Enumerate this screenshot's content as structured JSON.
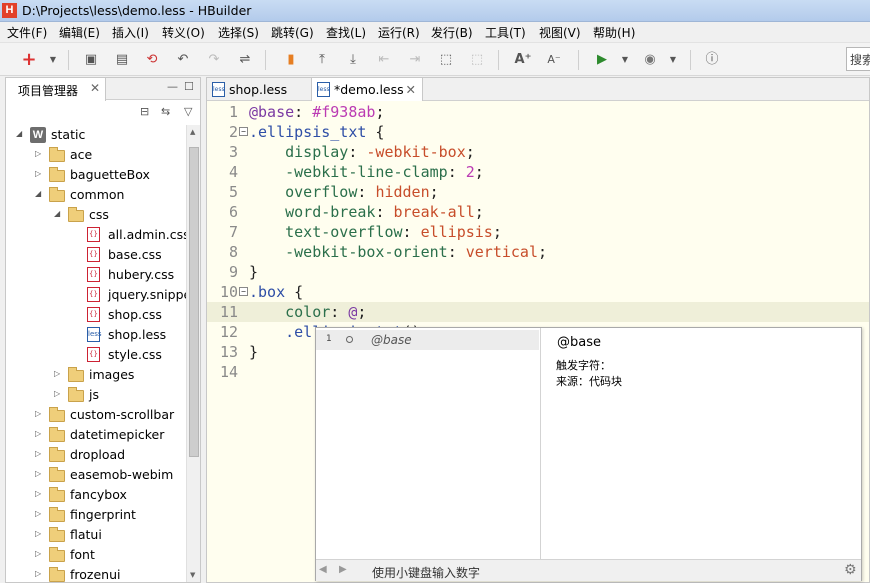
{
  "window": {
    "title": "D:\\Projects\\less\\demo.less  -  HBuilder",
    "logo": "H"
  },
  "menu": [
    "文件(F)",
    "编辑(E)",
    "插入(I)",
    "转义(O)",
    "选择(S)",
    "跳转(G)",
    "查找(L)",
    "运行(R)",
    "发行(B)",
    "工具(T)",
    "视图(V)",
    "帮助(H)"
  ],
  "toolbar": {
    "search_label": "搜索"
  },
  "project_panel": {
    "title": "项目管理器",
    "tree": [
      {
        "label": "static",
        "type": "project",
        "level": 0,
        "expanded": true
      },
      {
        "label": "ace",
        "type": "folder",
        "level": 1,
        "expanded": false
      },
      {
        "label": "baguetteBox",
        "type": "folder",
        "level": 1,
        "expanded": false
      },
      {
        "label": "common",
        "type": "folder",
        "level": 1,
        "expanded": true
      },
      {
        "label": "css",
        "type": "folder",
        "level": 2,
        "expanded": true
      },
      {
        "label": "all.admin.css",
        "type": "css",
        "level": 3
      },
      {
        "label": "base.css",
        "type": "css",
        "level": 3
      },
      {
        "label": "hubery.css",
        "type": "css",
        "level": 3
      },
      {
        "label": "jquery.snippe",
        "type": "css",
        "level": 3
      },
      {
        "label": "shop.css",
        "type": "css",
        "level": 3
      },
      {
        "label": "shop.less",
        "type": "less",
        "level": 3
      },
      {
        "label": "style.css",
        "type": "css",
        "level": 3
      },
      {
        "label": "images",
        "type": "folder",
        "level": 2,
        "expanded": false
      },
      {
        "label": "js",
        "type": "folder",
        "level": 2,
        "expanded": false
      },
      {
        "label": "custom-scrollbar",
        "type": "folder",
        "level": 1,
        "expanded": false
      },
      {
        "label": "datetimepicker",
        "type": "folder",
        "level": 1,
        "expanded": false
      },
      {
        "label": "dropload",
        "type": "folder",
        "level": 1,
        "expanded": false
      },
      {
        "label": "easemob-webim",
        "type": "folder",
        "level": 1,
        "expanded": false
      },
      {
        "label": "fancybox",
        "type": "folder",
        "level": 1,
        "expanded": false
      },
      {
        "label": "fingerprint",
        "type": "folder",
        "level": 1,
        "expanded": false
      },
      {
        "label": "flatui",
        "type": "folder",
        "level": 1,
        "expanded": false
      },
      {
        "label": "font",
        "type": "folder",
        "level": 1,
        "expanded": false
      },
      {
        "label": "frozenui",
        "type": "folder",
        "level": 1,
        "expanded": false
      }
    ]
  },
  "editor": {
    "tabs": [
      {
        "label": "shop.less",
        "active": false
      },
      {
        "label": "*demo.less",
        "active": true
      }
    ],
    "current_line": 11,
    "lines": [
      {
        "n": "1",
        "fold": false,
        "parts": [
          [
            "var",
            "@base"
          ],
          [
            "p",
            ": "
          ],
          [
            "n",
            "#f938ab"
          ],
          [
            "p",
            ";"
          ]
        ]
      },
      {
        "n": "2",
        "fold": true,
        "parts": [
          [
            "s",
            ".ellipsis_txt"
          ],
          [
            "p",
            " {"
          ]
        ]
      },
      {
        "n": "3",
        "fold": false,
        "parts": [
          [
            "p",
            "    "
          ],
          [
            "k",
            "display"
          ],
          [
            "p",
            ": "
          ],
          [
            "v",
            "-webkit-box"
          ],
          [
            "p",
            ";"
          ]
        ]
      },
      {
        "n": "4",
        "fold": false,
        "parts": [
          [
            "p",
            "    "
          ],
          [
            "k",
            "-webkit-line-clamp"
          ],
          [
            "p",
            ": "
          ],
          [
            "n",
            "2"
          ],
          [
            "p",
            ";"
          ]
        ]
      },
      {
        "n": "5",
        "fold": false,
        "parts": [
          [
            "p",
            "    "
          ],
          [
            "k",
            "overflow"
          ],
          [
            "p",
            ": "
          ],
          [
            "v",
            "hidden"
          ],
          [
            "p",
            ";"
          ]
        ]
      },
      {
        "n": "6",
        "fold": false,
        "parts": [
          [
            "p",
            "    "
          ],
          [
            "k",
            "word-break"
          ],
          [
            "p",
            ": "
          ],
          [
            "v",
            "break-all"
          ],
          [
            "p",
            ";"
          ]
        ]
      },
      {
        "n": "7",
        "fold": false,
        "parts": [
          [
            "p",
            "    "
          ],
          [
            "k",
            "text-overflow"
          ],
          [
            "p",
            ": "
          ],
          [
            "v",
            "ellipsis"
          ],
          [
            "p",
            ";"
          ]
        ]
      },
      {
        "n": "8",
        "fold": false,
        "parts": [
          [
            "p",
            "    "
          ],
          [
            "k",
            "-webkit-box-orient"
          ],
          [
            "p",
            ": "
          ],
          [
            "v",
            "vertical"
          ],
          [
            "p",
            ";"
          ]
        ]
      },
      {
        "n": "9",
        "fold": false,
        "parts": [
          [
            "p",
            "}"
          ]
        ]
      },
      {
        "n": "10",
        "fold": true,
        "parts": [
          [
            "s",
            ".box"
          ],
          [
            "p",
            " {"
          ]
        ]
      },
      {
        "n": "11",
        "fold": false,
        "parts": [
          [
            "p",
            "    "
          ],
          [
            "k",
            "color"
          ],
          [
            "p",
            ": "
          ],
          [
            "var",
            "@"
          ],
          [
            "p",
            ";"
          ]
        ]
      },
      {
        "n": "12",
        "fold": false,
        "parts": [
          [
            "p",
            "    "
          ],
          [
            "s",
            ".ellipsis_txt"
          ],
          [
            "p",
            "();"
          ]
        ]
      },
      {
        "n": "13",
        "fold": false,
        "parts": [
          [
            "p",
            "}"
          ]
        ]
      },
      {
        "n": "14",
        "fold": false,
        "parts": []
      }
    ]
  },
  "autocomplete": {
    "items": [
      {
        "index": "1",
        "text": "@base"
      }
    ],
    "detail": {
      "title": "@base",
      "line1": "触发字符：",
      "line2": "来源：代码块"
    },
    "status": "使用小键盘输入数字"
  }
}
